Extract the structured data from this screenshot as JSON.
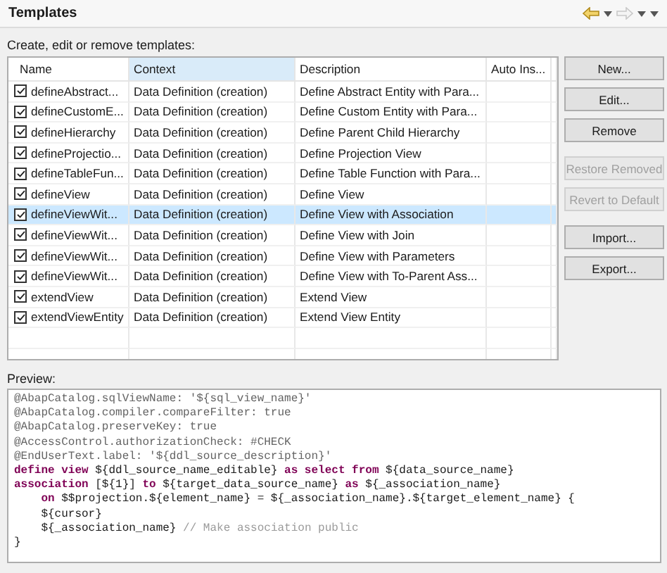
{
  "window": {
    "title": "Templates"
  },
  "intro": "Create, edit or remove templates:",
  "table": {
    "columns": [
      {
        "label": "Name",
        "highlighted": false
      },
      {
        "label": "Context",
        "highlighted": true
      },
      {
        "label": "Description",
        "highlighted": false
      },
      {
        "label": "Auto Ins...",
        "highlighted": false
      }
    ],
    "rows": [
      {
        "name": "defineAbstract...",
        "context": "Data Definition (creation)",
        "description": "Define Abstract Entity with Para...",
        "checked": true,
        "selected": false
      },
      {
        "name": "defineCustomE...",
        "context": "Data Definition (creation)",
        "description": "Define Custom Entity with Para...",
        "checked": true,
        "selected": false
      },
      {
        "name": "defineHierarchy",
        "context": "Data Definition (creation)",
        "description": "Define Parent Child Hierarchy",
        "checked": true,
        "selected": false
      },
      {
        "name": "defineProjectio...",
        "context": "Data Definition (creation)",
        "description": "Define Projection View",
        "checked": true,
        "selected": false
      },
      {
        "name": "defineTableFun...",
        "context": "Data Definition (creation)",
        "description": "Define Table Function with Para...",
        "checked": true,
        "selected": false
      },
      {
        "name": "defineView",
        "context": "Data Definition (creation)",
        "description": "Define View",
        "checked": true,
        "selected": false
      },
      {
        "name": "defineViewWit...",
        "context": "Data Definition (creation)",
        "description": "Define View with Association",
        "checked": true,
        "selected": true
      },
      {
        "name": "defineViewWit...",
        "context": "Data Definition (creation)",
        "description": "Define View with Join",
        "checked": true,
        "selected": false
      },
      {
        "name": "defineViewWit...",
        "context": "Data Definition (creation)",
        "description": "Define View with Parameters",
        "checked": true,
        "selected": false
      },
      {
        "name": "defineViewWit...",
        "context": "Data Definition (creation)",
        "description": "Define View with To-Parent Ass...",
        "checked": true,
        "selected": false
      },
      {
        "name": "extendView",
        "context": "Data Definition (creation)",
        "description": "Extend View",
        "checked": true,
        "selected": false
      },
      {
        "name": "extendViewEntity",
        "context": "Data Definition (creation)",
        "description": "Extend View Entity",
        "checked": true,
        "selected": false
      }
    ]
  },
  "button_groups": [
    [
      {
        "label": "New...",
        "disabled": false
      },
      {
        "label": "Edit...",
        "disabled": false
      },
      {
        "label": "Remove",
        "disabled": false
      }
    ],
    [
      {
        "label": "Restore Removed",
        "disabled": true
      },
      {
        "label": "Revert to Default",
        "disabled": true
      }
    ],
    [
      {
        "label": "Import...",
        "disabled": false
      },
      {
        "label": "Export...",
        "disabled": false
      }
    ]
  ],
  "preview": {
    "label": "Preview:",
    "lines": [
      [
        {
          "kind": "annotation",
          "text": "@AbapCatalog.sqlViewName: '${sql_view_name}'"
        }
      ],
      [
        {
          "kind": "annotation",
          "text": "@AbapCatalog.compiler.compareFilter: true"
        }
      ],
      [
        {
          "kind": "annotation",
          "text": "@AbapCatalog.preserveKey: true"
        }
      ],
      [
        {
          "kind": "annotation",
          "text": "@AccessControl.authorizationCheck: #CHECK"
        }
      ],
      [
        {
          "kind": "annotation",
          "text": "@EndUserText.label: '${ddl_source_description}'"
        }
      ],
      [
        {
          "kind": "keyword",
          "text": "define view "
        },
        {
          "kind": "plain",
          "text": "${ddl_source_name_editable} "
        },
        {
          "kind": "keyword",
          "text": "as select from "
        },
        {
          "kind": "plain",
          "text": "${data_source_name}"
        }
      ],
      [
        {
          "kind": "keyword",
          "text": "association "
        },
        {
          "kind": "plain",
          "text": "[${1}] "
        },
        {
          "kind": "keyword",
          "text": "to "
        },
        {
          "kind": "plain",
          "text": "${target_data_source_name} "
        },
        {
          "kind": "keyword",
          "text": "as "
        },
        {
          "kind": "plain",
          "text": "${_association_name}"
        }
      ],
      [
        {
          "kind": "keyword",
          "text": "    on "
        },
        {
          "kind": "plain",
          "text": "$$projection.${element_name} = ${_association_name}.${target_element_name} {"
        }
      ],
      [
        {
          "kind": "plain",
          "text": "    ${cursor}"
        }
      ],
      [
        {
          "kind": "plain",
          "text": "    ${_association_name} "
        },
        {
          "kind": "comment",
          "text": "// Make association public"
        }
      ],
      [
        {
          "kind": "plain",
          "text": "}"
        }
      ]
    ]
  }
}
